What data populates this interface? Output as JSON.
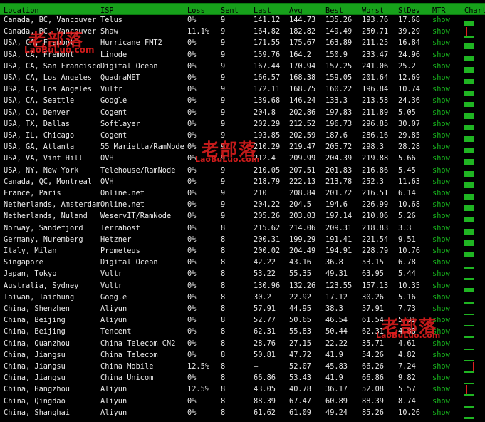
{
  "headers": [
    "Location",
    "ISP",
    "Loss",
    "Sent",
    "Last",
    "Avg",
    "Best",
    "Worst",
    "StDev",
    "MTR",
    "Chart"
  ],
  "rows": [
    {
      "location": "Canada, BC, Vancouver",
      "isp": "Telus",
      "loss": "0%",
      "sent": "9",
      "last": "141.12",
      "avg": "144.73",
      "best": "135.26",
      "worst": "193.76",
      "stdev": "17.68",
      "mtr": "show",
      "level": 0.55,
      "spike": false
    },
    {
      "location": "Canada, BC, Vancouver",
      "isp": "Shaw",
      "loss": "11.1%",
      "sent": "9",
      "last": "164.82",
      "avg": "182.82",
      "best": "149.49",
      "worst": "250.71",
      "stdev": "39.29",
      "mtr": "show",
      "level": 0.1,
      "spike": true
    },
    {
      "location": "USA, CA, Fremont",
      "isp": "Hurricane FMT2",
      "loss": "0%",
      "sent": "9",
      "last": "171.55",
      "avg": "175.67",
      "best": "163.89",
      "worst": "211.25",
      "stdev": "16.84",
      "mtr": "show",
      "level": 0.6,
      "spike": false
    },
    {
      "location": "USA, CA, Fremont",
      "isp": "Linode",
      "loss": "0%",
      "sent": "9",
      "last": "159.76",
      "avg": "164.2",
      "best": "150.9",
      "worst": "233.47",
      "stdev": "24.96",
      "mtr": "show",
      "level": 0.6,
      "spike": false
    },
    {
      "location": "USA, CA, San Francisco",
      "isp": "Digital Ocean",
      "loss": "0%",
      "sent": "9",
      "last": "167.44",
      "avg": "170.94",
      "best": "157.25",
      "worst": "241.06",
      "stdev": "25.2",
      "mtr": "show",
      "level": 0.6,
      "spike": false
    },
    {
      "location": "USA, CA, Los Angeles",
      "isp": "QuadraNET",
      "loss": "0%",
      "sent": "9",
      "last": "166.57",
      "avg": "168.38",
      "best": "159.05",
      "worst": "201.64",
      "stdev": "12.69",
      "mtr": "show",
      "level": 0.55,
      "spike": false
    },
    {
      "location": "USA, CA, Los Angeles",
      "isp": "Vultr",
      "loss": "0%",
      "sent": "9",
      "last": "172.11",
      "avg": "168.75",
      "best": "160.22",
      "worst": "196.84",
      "stdev": "10.74",
      "mtr": "show",
      "level": 0.55,
      "spike": false
    },
    {
      "location": "USA, CA, Seattle",
      "isp": "Google",
      "loss": "0%",
      "sent": "9",
      "last": "139.68",
      "avg": "146.24",
      "best": "133.3",
      "worst": "213.58",
      "stdev": "24.36",
      "mtr": "show",
      "level": 0.55,
      "spike": false
    },
    {
      "location": "USA, CO, Denver",
      "isp": "Cogent",
      "loss": "0%",
      "sent": "9",
      "last": "204.8",
      "avg": "202.86",
      "best": "197.83",
      "worst": "211.89",
      "stdev": "5.05",
      "mtr": "show",
      "level": 0.6,
      "spike": false
    },
    {
      "location": "USA, TX, Dallas",
      "isp": "Softlayer",
      "loss": "0%",
      "sent": "9",
      "last": "202.29",
      "avg": "212.52",
      "best": "196.73",
      "worst": "296.85",
      "stdev": "30.07",
      "mtr": "show",
      "level": 0.6,
      "spike": false
    },
    {
      "location": "USA, IL, Chicago",
      "isp": "Cogent",
      "loss": "0%",
      "sent": "9",
      "last": "193.85",
      "avg": "202.59",
      "best": "187.6",
      "worst": "286.16",
      "stdev": "29.85",
      "mtr": "show",
      "level": 0.6,
      "spike": false
    },
    {
      "location": "USA, GA, Atlanta",
      "isp": "55 Marietta/RamNode",
      "loss": "0%",
      "sent": "9",
      "last": "210.29",
      "avg": "219.47",
      "best": "205.72",
      "worst": "298.3",
      "stdev": "28.28",
      "mtr": "show",
      "level": 0.6,
      "spike": false
    },
    {
      "location": "USA, VA, Vint Hill",
      "isp": "OVH",
      "loss": "0%",
      "sent": "9",
      "last": "212.4",
      "avg": "209.99",
      "best": "204.39",
      "worst": "219.88",
      "stdev": "5.66",
      "mtr": "show",
      "level": 0.6,
      "spike": false
    },
    {
      "location": "USA, NY, New York",
      "isp": "Telehouse/RamNode",
      "loss": "0%",
      "sent": "9",
      "last": "210.05",
      "avg": "207.51",
      "best": "201.83",
      "worst": "216.86",
      "stdev": "5.45",
      "mtr": "show",
      "level": 0.6,
      "spike": false
    },
    {
      "location": "Canada, QC, Montreal",
      "isp": "OVH",
      "loss": "0%",
      "sent": "9",
      "last": "218.79",
      "avg": "222.13",
      "best": "213.78",
      "worst": "252.3",
      "stdev": "11.63",
      "mtr": "show",
      "level": 0.6,
      "spike": false
    },
    {
      "location": "France, Paris",
      "isp": "Online.net",
      "loss": "0%",
      "sent": "9",
      "last": "210",
      "avg": "208.84",
      "best": "201.72",
      "worst": "216.51",
      "stdev": "6.14",
      "mtr": "show",
      "level": 0.6,
      "spike": false
    },
    {
      "location": "Netherlands, Amsterdam",
      "isp": "Online.net",
      "loss": "0%",
      "sent": "9",
      "last": "204.22",
      "avg": "204.5",
      "best": "194.6",
      "worst": "226.99",
      "stdev": "10.68",
      "mtr": "show",
      "level": 0.6,
      "spike": false
    },
    {
      "location": "Netherlands, Nuland",
      "isp": "WeservIT/RamNode",
      "loss": "0%",
      "sent": "9",
      "last": "205.26",
      "avg": "203.03",
      "best": "197.14",
      "worst": "210.06",
      "stdev": "5.26",
      "mtr": "show",
      "level": 0.6,
      "spike": false
    },
    {
      "location": "Norway, Sandefjord",
      "isp": "Terrahost",
      "loss": "0%",
      "sent": "8",
      "last": "215.62",
      "avg": "214.06",
      "best": "209.31",
      "worst": "218.83",
      "stdev": "3.3",
      "mtr": "show",
      "level": 0.6,
      "spike": false
    },
    {
      "location": "Germany, Nuremberg",
      "isp": "Hetzner",
      "loss": "0%",
      "sent": "8",
      "last": "200.31",
      "avg": "199.29",
      "best": "191.41",
      "worst": "221.54",
      "stdev": "9.51",
      "mtr": "show",
      "level": 0.6,
      "spike": false
    },
    {
      "location": "Italy, Milan",
      "isp": "Prometeus",
      "loss": "0%",
      "sent": "8",
      "last": "200.02",
      "avg": "204.49",
      "best": "194.91",
      "worst": "228.79",
      "stdev": "10.76",
      "mtr": "show",
      "level": 0.6,
      "spike": false
    },
    {
      "location": "Singapore",
      "isp": "Digital Ocean",
      "loss": "0%",
      "sent": "8",
      "last": "42.22",
      "avg": "43.16",
      "best": "36.8",
      "worst": "53.15",
      "stdev": "6.78",
      "mtr": "show",
      "level": 0.15,
      "spike": false
    },
    {
      "location": "Japan, Tokyo",
      "isp": "Vultr",
      "loss": "0%",
      "sent": "8",
      "last": "53.22",
      "avg": "55.35",
      "best": "49.31",
      "worst": "63.95",
      "stdev": "5.44",
      "mtr": "show",
      "level": 0.2,
      "spike": false
    },
    {
      "location": "Australia, Sydney",
      "isp": "Vultr",
      "loss": "0%",
      "sent": "8",
      "last": "130.96",
      "avg": "132.26",
      "best": "123.55",
      "worst": "157.13",
      "stdev": "10.35",
      "mtr": "show",
      "level": 0.45,
      "spike": false
    },
    {
      "location": "Taiwan, Taichung",
      "isp": "Google",
      "loss": "0%",
      "sent": "8",
      "last": "30.2",
      "avg": "22.92",
      "best": "17.12",
      "worst": "30.26",
      "stdev": "5.16",
      "mtr": "show",
      "level": 0.1,
      "spike": false
    },
    {
      "location": "China, Shenzhen",
      "isp": "Aliyun",
      "loss": "0%",
      "sent": "8",
      "last": "57.91",
      "avg": "44.95",
      "best": "38.3",
      "worst": "57.91",
      "stdev": "7.73",
      "mtr": "show",
      "level": 0.15,
      "spike": false
    },
    {
      "location": "China, Beijing",
      "isp": "Aliyun",
      "loss": "0%",
      "sent": "8",
      "last": "52.77",
      "avg": "50.65",
      "best": "46.54",
      "worst": "61.54",
      "stdev": "5.31",
      "mtr": "show",
      "level": 0.15,
      "spike": false
    },
    {
      "location": "China, Beijing",
      "isp": "Tencent",
      "loss": "0%",
      "sent": "8",
      "last": "62.31",
      "avg": "55.83",
      "best": "50.44",
      "worst": "62.31",
      "stdev": "4.88",
      "mtr": "show",
      "level": 0.15,
      "spike": false
    },
    {
      "location": "China, Quanzhou",
      "isp": "China Telecom CN2",
      "loss": "0%",
      "sent": "8",
      "last": "28.76",
      "avg": "27.15",
      "best": "22.22",
      "worst": "35.71",
      "stdev": "4.61",
      "mtr": "show",
      "level": 0.1,
      "spike": false
    },
    {
      "location": "China, Jiangsu",
      "isp": "China Telecom",
      "loss": "0%",
      "sent": "8",
      "last": "50.81",
      "avg": "47.72",
      "best": "41.9",
      "worst": "54.26",
      "stdev": "4.82",
      "mtr": "show",
      "level": 0.15,
      "spike": false
    },
    {
      "location": "China, Jiangsu",
      "isp": "China Mobile",
      "loss": "12.5%",
      "sent": "8",
      "last": "–",
      "avg": "52.07",
      "best": "45.83",
      "worst": "66.26",
      "stdev": "7.24",
      "mtr": "show",
      "level": 0.1,
      "spike": true
    },
    {
      "location": "China, Jiangsu",
      "isp": "China Unicom",
      "loss": "0%",
      "sent": "8",
      "last": "66.86",
      "avg": "53.43",
      "best": "41.9",
      "worst": "66.86",
      "stdev": "9.82",
      "mtr": "show",
      "level": 0.15,
      "spike": false
    },
    {
      "location": "China, Hangzhou",
      "isp": "Aliyun",
      "loss": "12.5%",
      "sent": "8",
      "last": "43.05",
      "avg": "40.78",
      "best": "36.17",
      "worst": "52.08",
      "stdev": "5.57",
      "mtr": "show",
      "level": 0.1,
      "spike": true
    },
    {
      "location": "China, Qingdao",
      "isp": "Aliyun",
      "loss": "0%",
      "sent": "8",
      "last": "88.39",
      "avg": "67.47",
      "best": "60.89",
      "worst": "88.39",
      "stdev": "8.74",
      "mtr": "show",
      "level": 0.25,
      "spike": false
    },
    {
      "location": "China, Shanghai",
      "isp": "Aliyun",
      "loss": "0%",
      "sent": "8",
      "last": "61.62",
      "avg": "61.09",
      "best": "49.24",
      "worst": "85.26",
      "stdev": "10.26",
      "mtr": "show",
      "level": 0.2,
      "spike": false
    }
  ],
  "watermarks": [
    {
      "cn": "老部落",
      "url": "LaoBuLuo.com"
    },
    {
      "cn": "老部落",
      "url": "LaoBuLuo.com"
    },
    {
      "cn": "老部落",
      "url": "LaoBuLuo.com"
    }
  ]
}
